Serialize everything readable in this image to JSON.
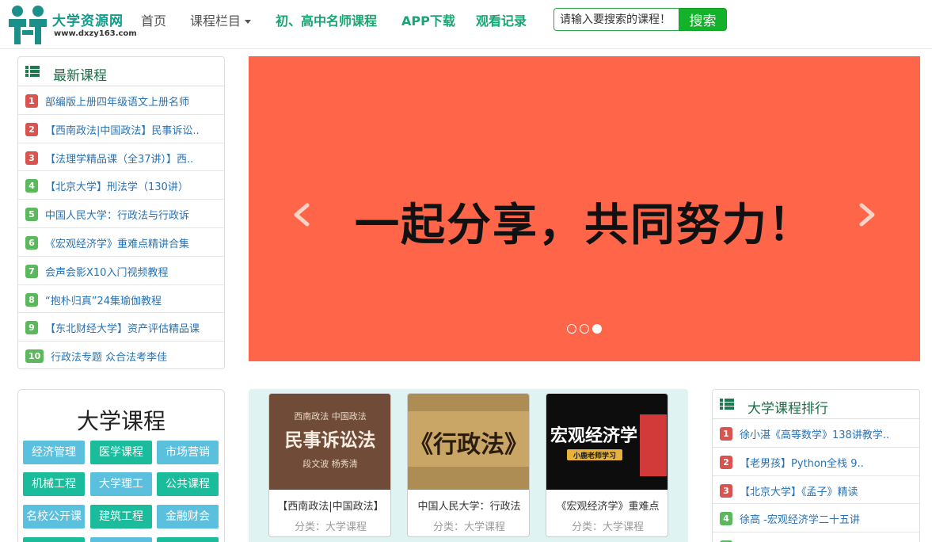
{
  "site": {
    "name": "大学资源网",
    "url": "www.dxzy163.com"
  },
  "nav": {
    "items": [
      {
        "label": "首页"
      },
      {
        "label": "课程栏目"
      },
      {
        "label": "初、高中名师课程"
      },
      {
        "label": "APP下载"
      },
      {
        "label": "观看记录"
      }
    ]
  },
  "search": {
    "placeholder": "请输入要搜索的课程！",
    "button": "搜索"
  },
  "latest": {
    "title": "最新课程",
    "items": [
      {
        "rank": "1",
        "text": "部编版上册四年级语文上册名师"
      },
      {
        "rank": "2",
        "text": "【西南政法|中国政法】民事诉讼.."
      },
      {
        "rank": "3",
        "text": "【法理学精品课（全37讲）】西.."
      },
      {
        "rank": "4",
        "text": "【北京大学】刑法学（130讲）"
      },
      {
        "rank": "5",
        "text": "中国人民大学：行政法与行政诉"
      },
      {
        "rank": "6",
        "text": "《宏观经济学》重难点精讲合集"
      },
      {
        "rank": "7",
        "text": "会声会影X10入门视频教程"
      },
      {
        "rank": "8",
        "text": "“抱朴归真”24集瑜伽教程"
      },
      {
        "rank": "9",
        "text": "【东北财经大学】资产评估精品课"
      },
      {
        "rank": "10",
        "text": "行政法专题 众合法考李佳"
      }
    ]
  },
  "carousel": {
    "slide_text": "一起分享，共同努力！",
    "slide_count": 3,
    "active_index": 2
  },
  "categories": {
    "title": "大学课程",
    "items": [
      "经济管理",
      "医学课程",
      "市场营销",
      "机械工程",
      "大学理工",
      "公共课程",
      "名校公开课",
      "建筑工程",
      "金融财会"
    ]
  },
  "featured": [
    {
      "cover_text": [
        "西南政法 中国政法",
        "民事诉讼法",
        "段文波 杨秀清"
      ],
      "title": "【西南政法|中国政法】",
      "category": "分类：大学课程"
    },
    {
      "cover_text": [
        "《行政法》"
      ],
      "title": "中国人民大学：行政法",
      "category": "分类：大学课程"
    },
    {
      "cover_text": [
        "宏观经济学",
        "小鹿老师学习"
      ],
      "title": "《宏观经济学》重难点",
      "category": "分类：大学课程"
    }
  ],
  "ranking": {
    "title": "大学课程排行",
    "items": [
      {
        "rank": "1",
        "text": "徐小湛《高等数学》138讲教学.."
      },
      {
        "rank": "2",
        "text": "【老男孩】Python全栈 9.."
      },
      {
        "rank": "3",
        "text": "【北京大学】《孟子》精读"
      },
      {
        "rank": "4",
        "text": "徐高 -宏观经济学二十五讲"
      }
    ]
  },
  "colors": {
    "accent": "#19a573",
    "carousel_bg": "#fe6549",
    "badge_red": "#d9534f",
    "badge_green": "#5cb85c",
    "link": "#2672b5"
  }
}
